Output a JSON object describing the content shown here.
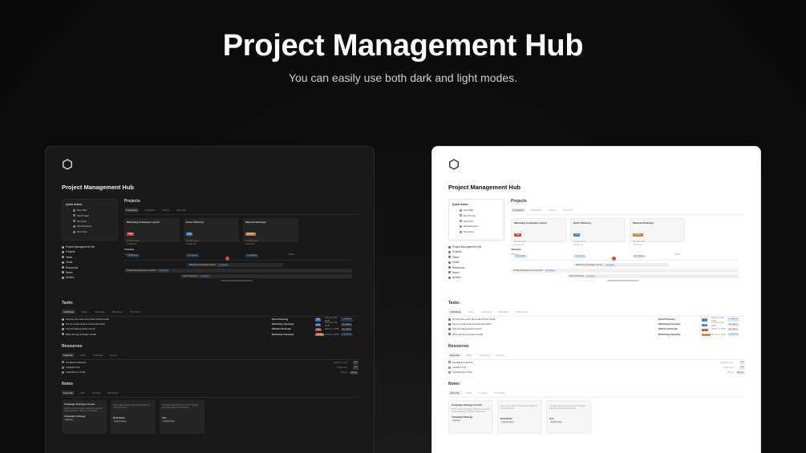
{
  "hero": {
    "title": "Project Management Hub",
    "subtitle": "You can easily use both dark and light modes."
  },
  "colors": {
    "background": "#0d0d0d",
    "dark_panel": "#191919",
    "light_panel": "#ffffff",
    "today_marker": "#e0483a",
    "badge_red": "#c94a3c",
    "badge_blue": "#3e7dbf",
    "badge_orange": "#c58032"
  },
  "page": {
    "logo_icon": "hexagon-icon",
    "title": "Project Management Hub"
  },
  "quick_action": {
    "title": "Quick Action",
    "items": [
      "New Task",
      "New Project",
      "New Note",
      "New Resource",
      "New Goal"
    ]
  },
  "nav": {
    "items": [
      "Project Management Hub",
      "Projects",
      "Tasks",
      "Goals",
      "Resources",
      "Notes",
      "Archive"
    ]
  },
  "projects": {
    "title": "Projects",
    "tabs": [
      "In progress",
      "Unfinished",
      "Priority",
      "This Year"
    ],
    "cards": [
      {
        "name": "Marketing Campaign Launch",
        "badge": "High",
        "meta1": "2/5 tasks done",
        "meta2": "18 days left",
        "status": "In progress"
      },
      {
        "name": "Event Planning",
        "badge": "Low",
        "meta1": "1/4 tasks done",
        "meta2": "25 days left",
        "status": "In progress"
      },
      {
        "name": "Website Redesign",
        "badge": "Medium",
        "meta1": "3/5 tasks done",
        "meta2": "9 days left",
        "status": "In progress"
      }
    ],
    "timeline": {
      "title": "Timeline",
      "months": [
        "February",
        "March"
      ],
      "bars": [
        {
          "label": "Marketing Campaign Launch",
          "status": "In progress"
        },
        {
          "label": "Product Development & Launch",
          "status": "Not started"
        },
        {
          "label": "Event Planning",
          "status": "In progress"
        }
      ]
    }
  },
  "tasks": {
    "title": "Tasks",
    "tabs": [
      "Unfinished",
      "Today",
      "Upcoming",
      "This Week",
      "This Month"
    ],
    "rows": [
      {
        "name": "Promote the event via email & social media",
        "project": "Event Planning",
        "priority": "Low",
        "date": "February 20, 2025",
        "status": "In progress"
      },
      {
        "name": "Set up social media & email automation",
        "project": "Marketing Campaign",
        "priority": "Low",
        "date": "February 26, 2025",
        "status": "Not started"
      },
      {
        "name": "Test and debug before launch",
        "project": "Website Redesign",
        "priority": "High",
        "date": "March 1, 2025",
        "status": "Not started"
      },
      {
        "name": "Write ad copy & design visuals",
        "project": "Marketing Campaign",
        "priority": "Medium",
        "date": "March 2, 2025",
        "status": "In progress"
      }
    ]
  },
  "resources": {
    "title": "Resources",
    "tabs": [
      "Favourite",
      "Ideas",
      "To Review",
      "Recent"
    ],
    "rows": [
      {
        "name": "Feedback Collection",
        "source": "typeform.com",
        "type": "Tool"
      },
      {
        "name": "Analytics Tool",
        "source": "hotjar.com",
        "type": "Tool"
      },
      {
        "name": "Inspiration & UI Kits",
        "source": "ui8.net",
        "type": "Website"
      }
    ]
  },
  "notes": {
    "title": "Notes",
    "tabs": [
      "Favourite",
      "Draft",
      "On Hold",
      "This Week"
    ],
    "cards": [
      {
        "intro": "Campaign Strategy & Goals",
        "text": "Define clear campaign objectives, identify target audience, and key milestones.",
        "title": "Campaign Strategy",
        "tag": "Planning"
      },
      {
        "intro": "",
        "text": "Dark mode feature requested by 20% of surveyed users.",
        "title": "Dark Mode",
        "tag": "Feature Notes"
      },
      {
        "intro": "",
        "text": "Increase ads performance from Google Ads with weekly optimization.",
        "title": "Ads",
        "tag": "Growth Notes"
      }
    ]
  }
}
